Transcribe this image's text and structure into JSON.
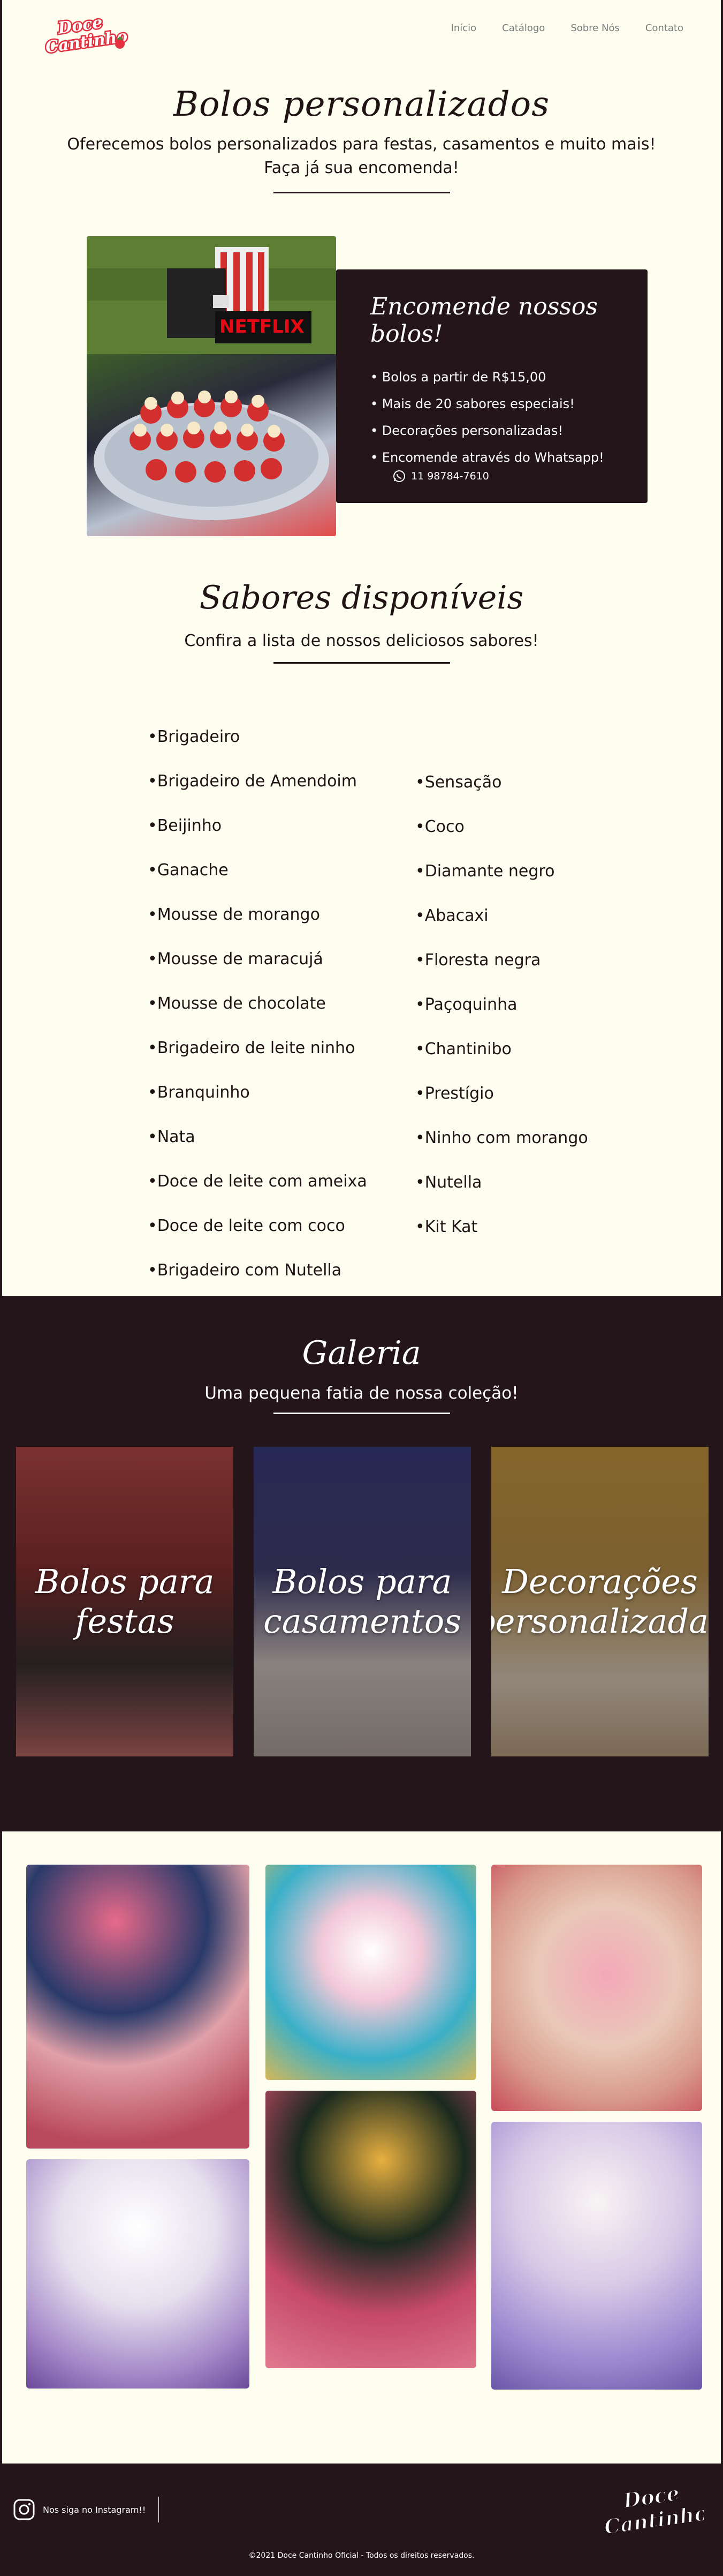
{
  "brand": {
    "logo_text_line1": "Doce",
    "logo_text_line2": "Cantinho",
    "primary_color": "#24151a",
    "accent_color": "#e2313f",
    "background_color": "#fdfdf0"
  },
  "nav": {
    "items": [
      "Início",
      "Catálogo",
      "Sobre Nós",
      "Contato"
    ]
  },
  "hero": {
    "title": "Bolos personalizados",
    "description_line1": "Oferecemos bolos personalizados para festas, casamentos e muito mais!",
    "description_line2": "Faça já sua encomenda!"
  },
  "promo": {
    "title": "Encomende nossos bolos!",
    "items": [
      "Bolos a partir de R$15,00",
      "Mais de 20 sabores especiais!",
      "Decorações personalizadas!",
      "Encomende através do Whatsapp!"
    ],
    "whatsapp": "11 98784-7610",
    "whatsapp_icon": "whatsapp-icon"
  },
  "flavors": {
    "title": "Sabores disponíveis",
    "subtitle": "Confira a lista de nossos deliciosos sabores!",
    "column_a": [
      "Brigadeiro",
      "Brigadeiro de Amendoim",
      "Beijinho",
      "Ganache",
      "Mousse de morango",
      "Mousse de maracujá",
      "Mousse de chocolate",
      "Brigadeiro de leite ninho",
      "Branquinho",
      "Nata",
      "Doce de leite com ameixa",
      "Doce de leite com coco",
      "Brigadeiro com Nutella"
    ],
    "column_b": [
      "Sensação",
      "Coco",
      "Diamante negro",
      "Abacaxi",
      "Floresta negra",
      "Paçoquinha",
      "Chantinibo",
      "Prestígio",
      "Ninho com morango",
      "Nutella",
      "Kit Kat"
    ]
  },
  "gallery": {
    "title": "Galeria",
    "subtitle": "Uma pequena fatia de nossa coleção!",
    "tiles": [
      {
        "line1": "Bolos para",
        "line2": "festas"
      },
      {
        "line1": "Bolos para",
        "line2": "casamentos"
      },
      {
        "line1": "Decorações",
        "line2": "personalizadas"
      }
    ]
  },
  "footer": {
    "instagram_text": "Nos siga no Instagram!!",
    "instagram_icon": "instagram-icon",
    "copyright": "©2021 Doce Cantinho Oficial - Todos os direitos reservados."
  }
}
